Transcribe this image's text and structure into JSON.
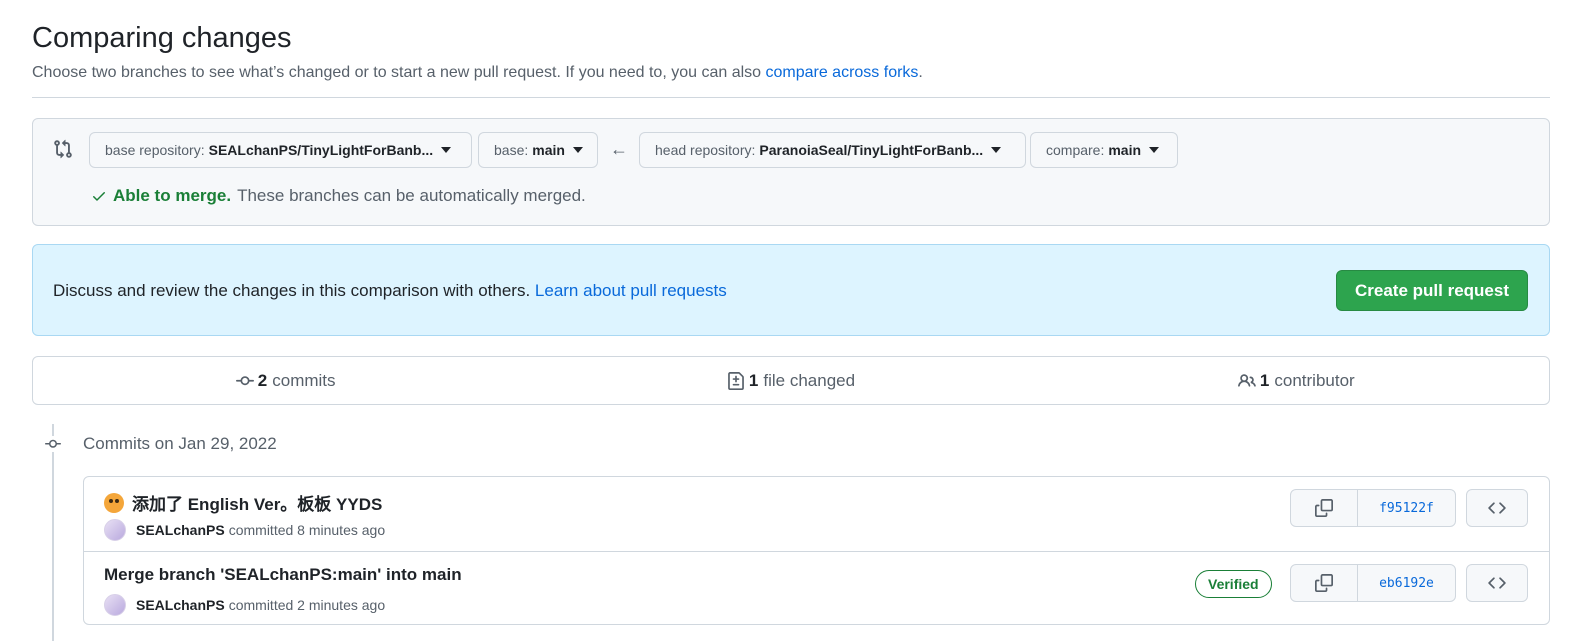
{
  "header": {
    "title": "Comparing changes",
    "subtitle": "Choose two branches to see what’s changed or to start a new pull request. If you need to, you can also ",
    "forks_link": "compare across forks",
    "subtitle_end": "."
  },
  "range": {
    "base_repo_label": "base repository:",
    "base_repo_value": "SEALchanPS/TinyLightForBanb...",
    "base_label": "base:",
    "base_value": "main",
    "head_repo_label": "head repository:",
    "head_repo_value": "ParanoiaSeal/TinyLightForBanb...",
    "compare_label": "compare:",
    "compare_value": "main",
    "merge_ok": "Able to merge.",
    "merge_text": "These branches can be automatically merged."
  },
  "info": {
    "text": "Discuss and review the changes in this comparison with others. ",
    "link": "Learn about pull requests",
    "create_button": "Create pull request"
  },
  "summary": {
    "commits_count": "2",
    "commits_label": "commits",
    "files_count": "1",
    "files_label": "file changed",
    "contributors_count": "1",
    "contributors_label": "contributor"
  },
  "commits": {
    "date_heading": "Commits on Jan 29, 2022",
    "items": [
      {
        "title": "添加了 English Ver。板板 YYDS",
        "author": "SEALchanPS",
        "meta": "committed 8 minutes ago",
        "sha": "f95122f",
        "verified": ""
      },
      {
        "title": "Merge branch 'SEALchanPS:main' into main",
        "author": "SEALchanPS",
        "meta": "committed 2 minutes ago",
        "sha": "eb6192e",
        "verified": "Verified"
      }
    ]
  },
  "colors": {
    "accent": "#0969da",
    "success": "#2da44e",
    "info_bg": "#ddf4ff"
  }
}
